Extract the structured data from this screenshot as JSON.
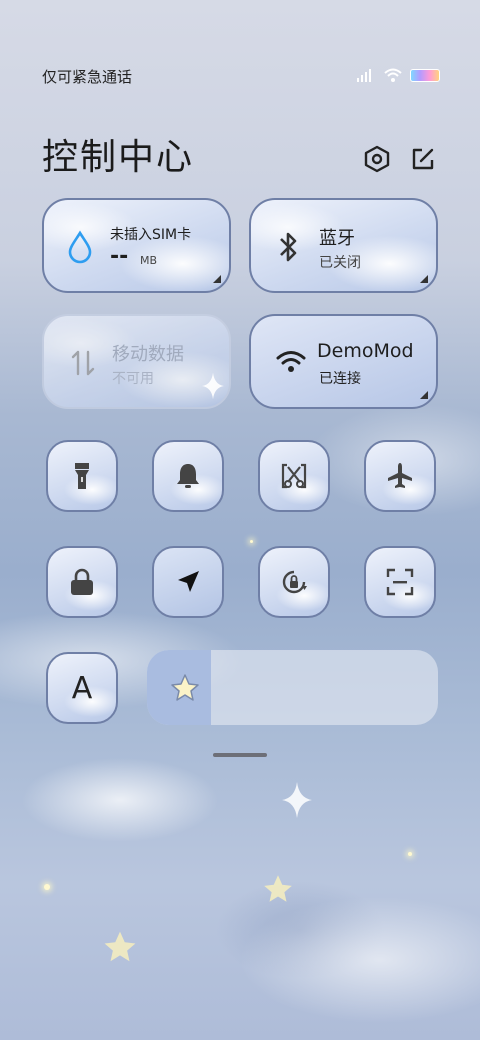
{
  "status_bar": {
    "carrier_text": "仅可紧急通话",
    "battery_color": "#b59bff"
  },
  "header": {
    "title": "控制中心",
    "settings_icon": "hexagon-settings-icon",
    "edit_icon": "edit-icon"
  },
  "tiles": {
    "data_usage": {
      "label": "未插入SIM卡",
      "value": "--",
      "unit": "MB",
      "icon": "water-drop-icon",
      "accent": "#2e9df0"
    },
    "bluetooth": {
      "label": "蓝牙",
      "status": "已关闭",
      "icon": "bluetooth-icon"
    },
    "mobile_data": {
      "label": "移动数据",
      "status": "不可用",
      "icon": "data-arrows-icon"
    },
    "wifi": {
      "label": "DemoMod",
      "status": "已连接",
      "icon": "wifi-icon"
    }
  },
  "toggles": [
    {
      "name": "flashlight",
      "icon": "flashlight-icon",
      "active": false
    },
    {
      "name": "ringer",
      "icon": "bell-icon",
      "active": false
    },
    {
      "name": "screenshot",
      "icon": "scissors-icon",
      "active": false
    },
    {
      "name": "airplane",
      "icon": "airplane-icon",
      "active": false
    },
    {
      "name": "lock",
      "icon": "lock-icon",
      "active": false
    },
    {
      "name": "location",
      "icon": "location-arrow-icon",
      "active": true
    },
    {
      "name": "rotation-lock",
      "icon": "rotation-lock-icon",
      "active": false
    },
    {
      "name": "scan",
      "icon": "scan-icon",
      "active": false
    }
  ],
  "bottom": {
    "font_icon": "font-size-icon",
    "font_glyph": "A",
    "brightness_icon": "star-icon",
    "brightness_level": 0.22
  }
}
